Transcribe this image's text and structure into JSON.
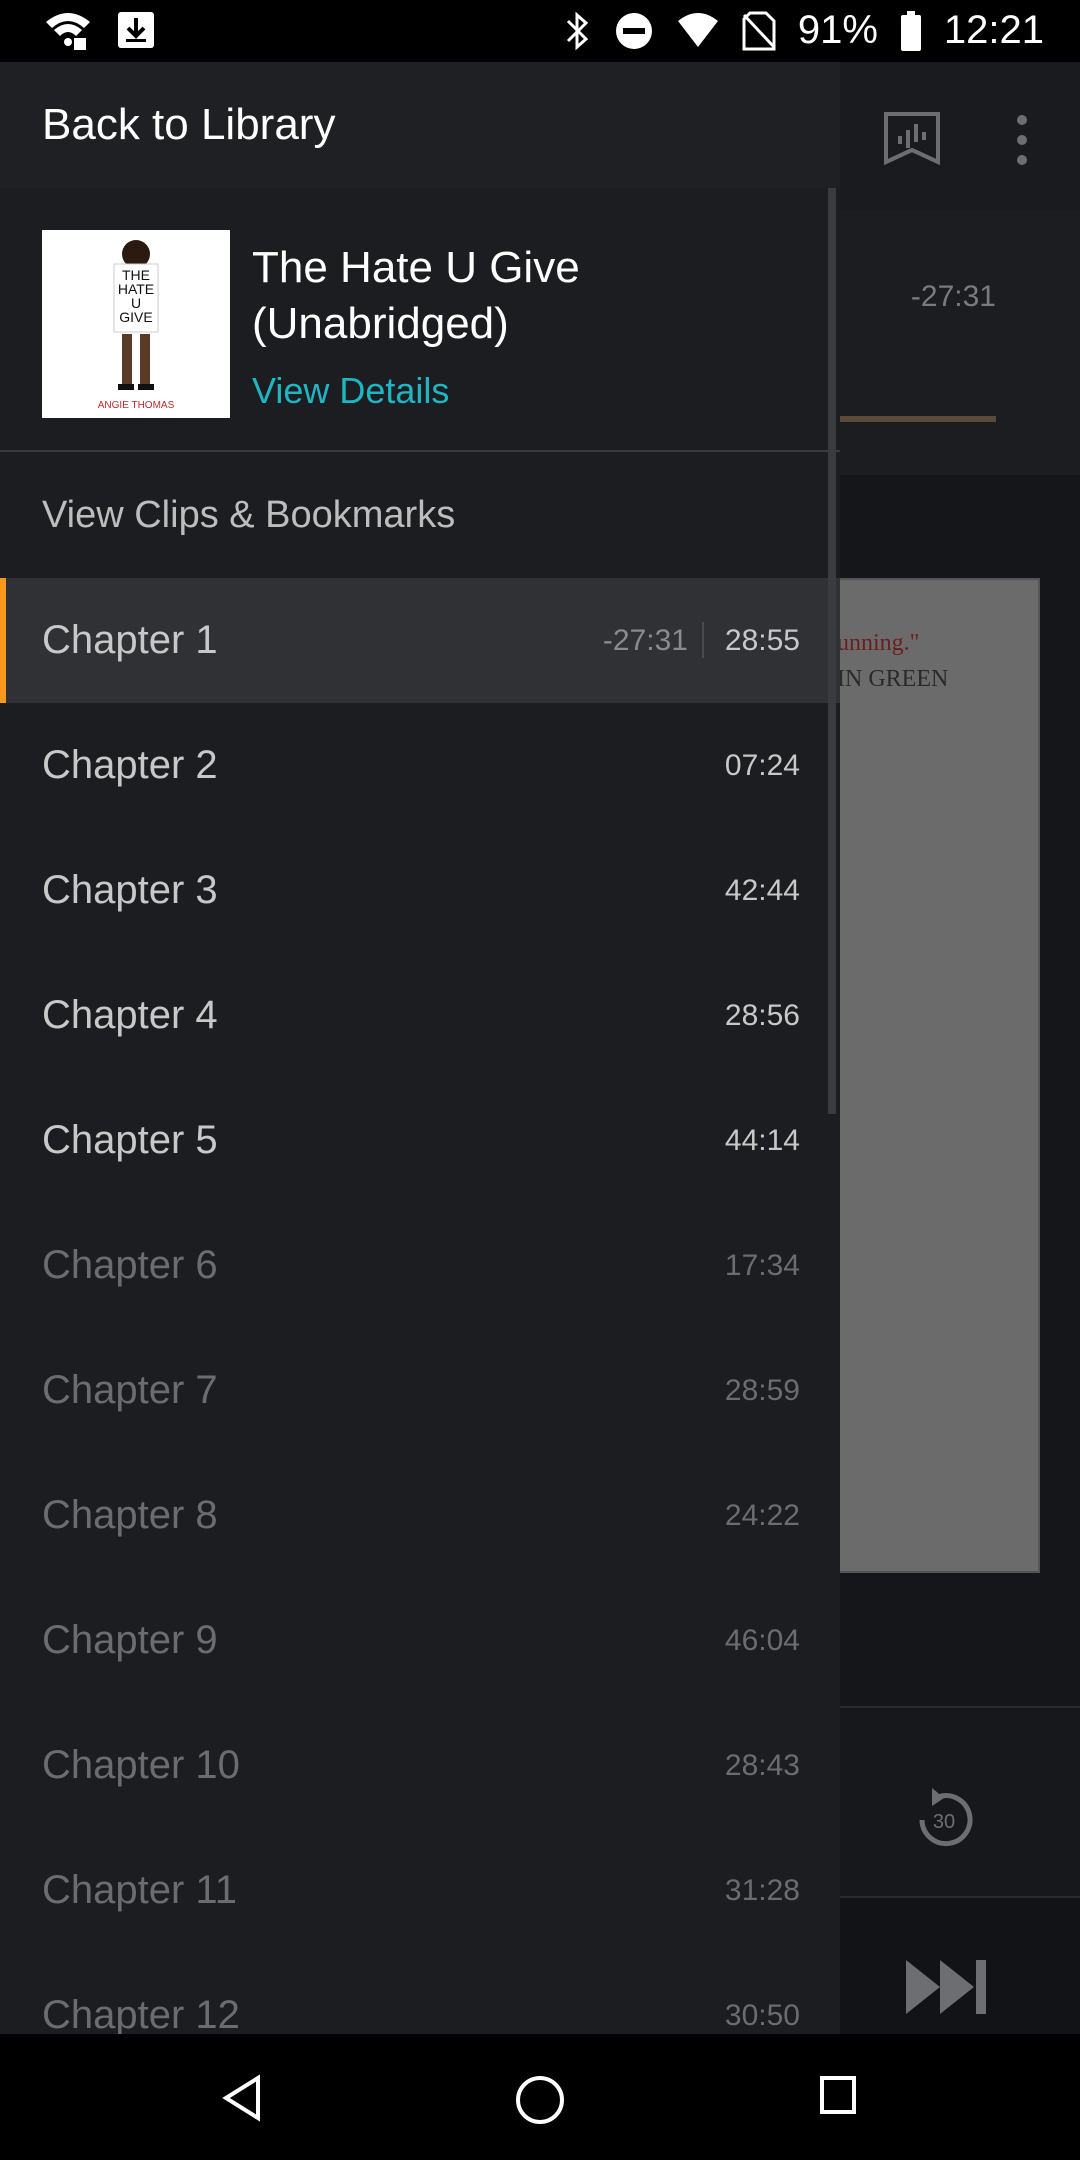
{
  "status_bar": {
    "battery_percent": "91%",
    "time": "12:21",
    "icons": [
      "wifi-icon",
      "download-icon",
      "bluetooth-icon",
      "do-not-disturb-icon",
      "signal-icon",
      "no-sim-icon",
      "battery-icon"
    ]
  },
  "player": {
    "time_remaining": "-27:31",
    "page_text_1": "unning.\"",
    "page_text_2": "IN GREEN",
    "skip_back_seconds": "30"
  },
  "drawer": {
    "back_label": "Back to Library",
    "book": {
      "title": "The Hate U Give (Unabridged)",
      "view_details": "View Details",
      "cover_title_lines": [
        "THE",
        "HATE",
        "U",
        "GIVE"
      ],
      "cover_author": "ANGIE THOMAS"
    },
    "clips_label": "View Clips & Bookmarks",
    "chapters": [
      {
        "name": "Chapter 1",
        "remaining": "-27:31",
        "duration": "28:55",
        "state": "active"
      },
      {
        "name": "Chapter 2",
        "duration": "07:24",
        "state": "normal"
      },
      {
        "name": "Chapter 3",
        "duration": "42:44",
        "state": "normal"
      },
      {
        "name": "Chapter 4",
        "duration": "28:56",
        "state": "normal"
      },
      {
        "name": "Chapter 5",
        "duration": "44:14",
        "state": "normal"
      },
      {
        "name": "Chapter 6",
        "duration": "17:34",
        "state": "dim"
      },
      {
        "name": "Chapter 7",
        "duration": "28:59",
        "state": "dim"
      },
      {
        "name": "Chapter 8",
        "duration": "24:22",
        "state": "dim"
      },
      {
        "name": "Chapter 9",
        "duration": "46:04",
        "state": "dim"
      },
      {
        "name": "Chapter 10",
        "duration": "28:43",
        "state": "dim"
      },
      {
        "name": "Chapter 11",
        "duration": "31:28",
        "state": "dim"
      },
      {
        "name": "Chapter 12",
        "duration": "30:50",
        "state": "dim"
      }
    ]
  },
  "colors": {
    "accent_orange": "#f7991c",
    "link_teal": "#1fb6c4"
  }
}
